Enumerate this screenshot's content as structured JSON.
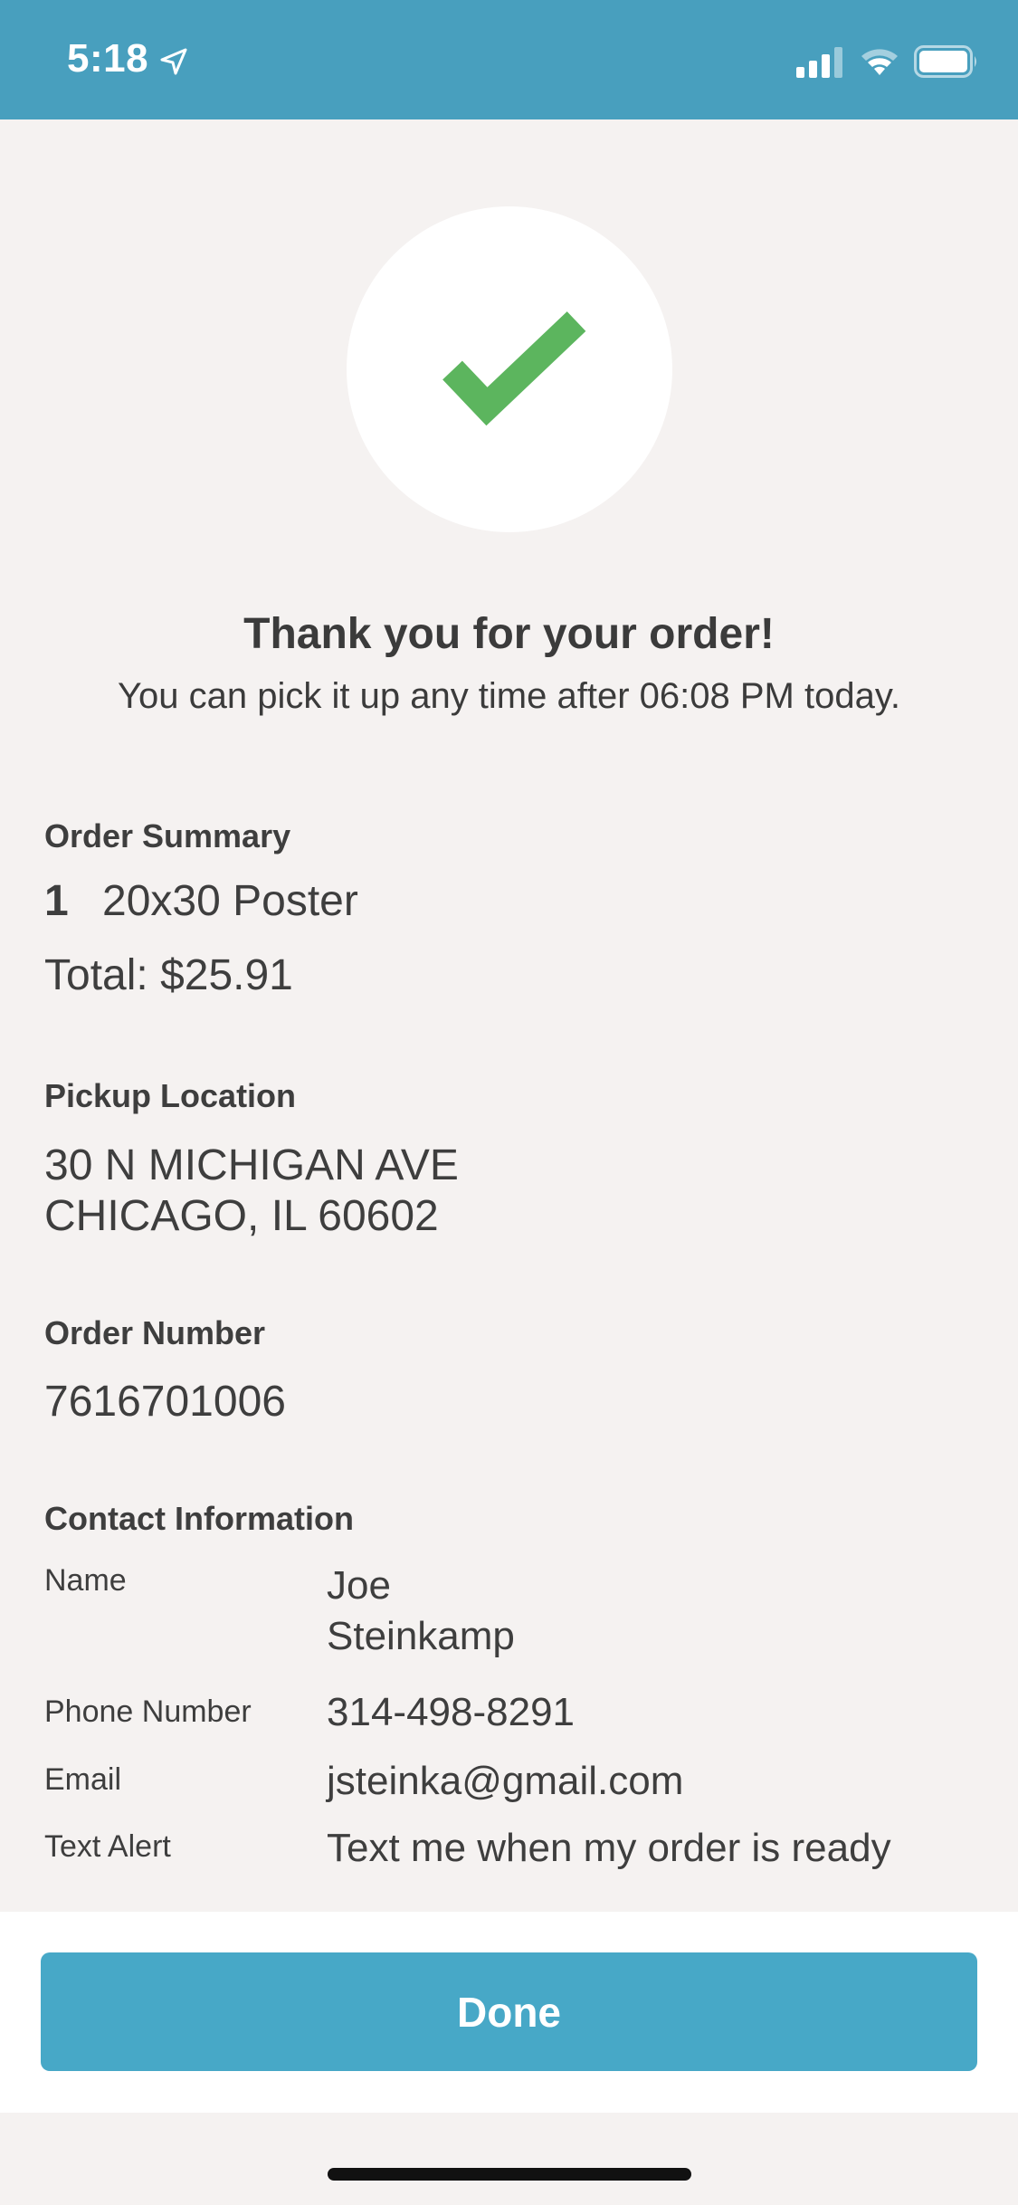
{
  "status_bar": {
    "time": "5:18"
  },
  "confirmation": {
    "title": "Thank you for your order!",
    "subtitle": "You can pick it up any time after 06:08 PM today."
  },
  "order_summary": {
    "label": "Order Summary",
    "items": [
      {
        "quantity": "1",
        "name": "20x30 Poster"
      }
    ],
    "total": "Total: $25.91"
  },
  "pickup_location": {
    "label": "Pickup Location",
    "address_line1": "30 N MICHIGAN AVE",
    "address_line2": "CHICAGO, IL 60602"
  },
  "order_number": {
    "label": "Order Number",
    "value": "7616701006"
  },
  "contact_information": {
    "label": "Contact Information",
    "name_label": "Name",
    "name_first": "Joe",
    "name_last": "Steinkamp",
    "phone_label": "Phone Number",
    "phone": "314-498-8291",
    "email_label": "Email",
    "email": "jsteinka@gmail.com",
    "text_alert_label": "Text Alert",
    "text_alert": "Text me when my order is ready"
  },
  "footer": {
    "done_label": "Done"
  },
  "colors": {
    "header": "#489fbe",
    "button": "#47a8c7",
    "check": "#5cb55e",
    "background": "#f5f2f1"
  }
}
